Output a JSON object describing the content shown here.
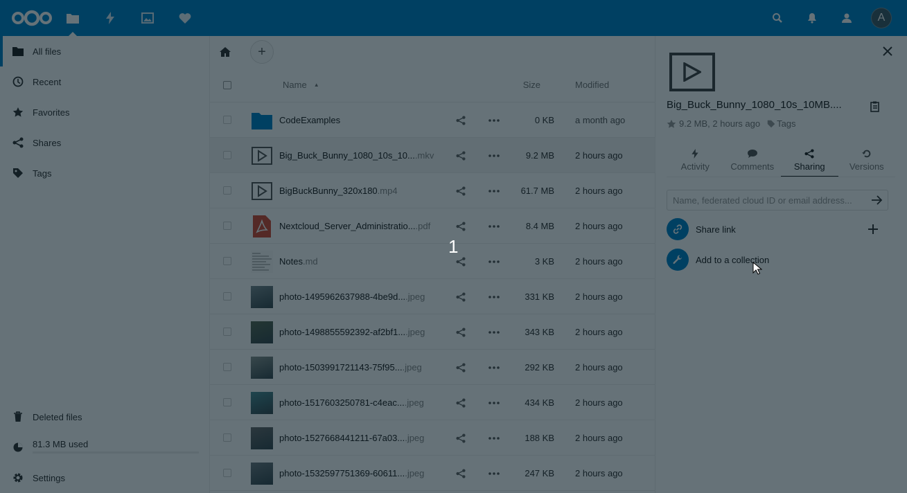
{
  "header": {
    "apps": [
      {
        "name": "files-icon",
        "active": true
      },
      {
        "name": "activity-icon",
        "active": false
      },
      {
        "name": "gallery-icon",
        "active": false
      },
      {
        "name": "favorites-icon",
        "active": false
      }
    ],
    "avatar_letter": "A"
  },
  "nav": {
    "items": [
      {
        "label": "All files",
        "icon": "folder-icon"
      },
      {
        "label": "Recent",
        "icon": "clock-icon"
      },
      {
        "label": "Favorites",
        "icon": "star-icon"
      },
      {
        "label": "Shares",
        "icon": "share-icon"
      },
      {
        "label": "Tags",
        "icon": "tag-icon"
      }
    ],
    "deleted_label": "Deleted files",
    "quota_label": "81.3 MB used",
    "settings_label": "Settings"
  },
  "table": {
    "col_name": "Name",
    "col_size": "Size",
    "col_modified": "Modified",
    "rows": [
      {
        "name": "CodeExamples",
        "ext": "",
        "size": "0 KB",
        "modified": "a month ago",
        "type": "folder"
      },
      {
        "name": "Big_Buck_Bunny_1080_10s_10...",
        "ext": ".mkv",
        "size": "9.2 MB",
        "modified": "2 hours ago",
        "type": "video"
      },
      {
        "name": "BigBuckBunny_320x180",
        "ext": ".mp4",
        "size": "61.7 MB",
        "modified": "2 hours ago",
        "type": "video"
      },
      {
        "name": "Nextcloud_Server_Administratio...",
        "ext": ".pdf",
        "size": "8.4 MB",
        "modified": "2 hours ago",
        "type": "pdf"
      },
      {
        "name": "Notes",
        "ext": ".md",
        "size": "3 KB",
        "modified": "2 hours ago",
        "type": "text"
      },
      {
        "name": "photo-1495962637988-4be9d...",
        "ext": ".jpeg",
        "size": "331 KB",
        "modified": "2 hours ago",
        "type": "image",
        "color": "#7a8a8f"
      },
      {
        "name": "photo-1498855592392-af2bf1...",
        "ext": ".jpeg",
        "size": "343 KB",
        "modified": "2 hours ago",
        "type": "image",
        "color": "#5b6b55"
      },
      {
        "name": "photo-1503991721143-75f95...",
        "ext": ".jpeg",
        "size": "292 KB",
        "modified": "2 hours ago",
        "type": "image",
        "color": "#8c9590"
      },
      {
        "name": "photo-1517603250781-c4eac...",
        "ext": ".jpeg",
        "size": "434 KB",
        "modified": "2 hours ago",
        "type": "image",
        "color": "#4e8f96"
      },
      {
        "name": "photo-1527668441211-67a03...",
        "ext": ".jpeg",
        "size": "188 KB",
        "modified": "2 hours ago",
        "type": "image",
        "color": "#6c6c6c"
      },
      {
        "name": "photo-1532597751369-60611...",
        "ext": ".jpeg",
        "size": "247 KB",
        "modified": "2 hours ago",
        "type": "image",
        "color": "#707a80"
      }
    ]
  },
  "sidebar": {
    "title": "Big_Buck_Bunny_1080_10s_10MB....",
    "meta": "9.2 MB, 2 hours ago",
    "tags_label": "Tags",
    "tabs": [
      {
        "label": "Activity",
        "icon": "activity-icon"
      },
      {
        "label": "Comments",
        "icon": "comment-icon"
      },
      {
        "label": "Sharing",
        "icon": "share-icon",
        "active": true
      },
      {
        "label": "Versions",
        "icon": "history-icon"
      }
    ],
    "share_placeholder": "Name, federated cloud ID or email address...",
    "share_link_label": "Share link",
    "collection_label": "Add to a collection"
  },
  "overlay": {
    "step_number": "1"
  },
  "colors": {
    "brand": "#0082c9",
    "overlay": "rgba(0,20,30,0.60)"
  }
}
